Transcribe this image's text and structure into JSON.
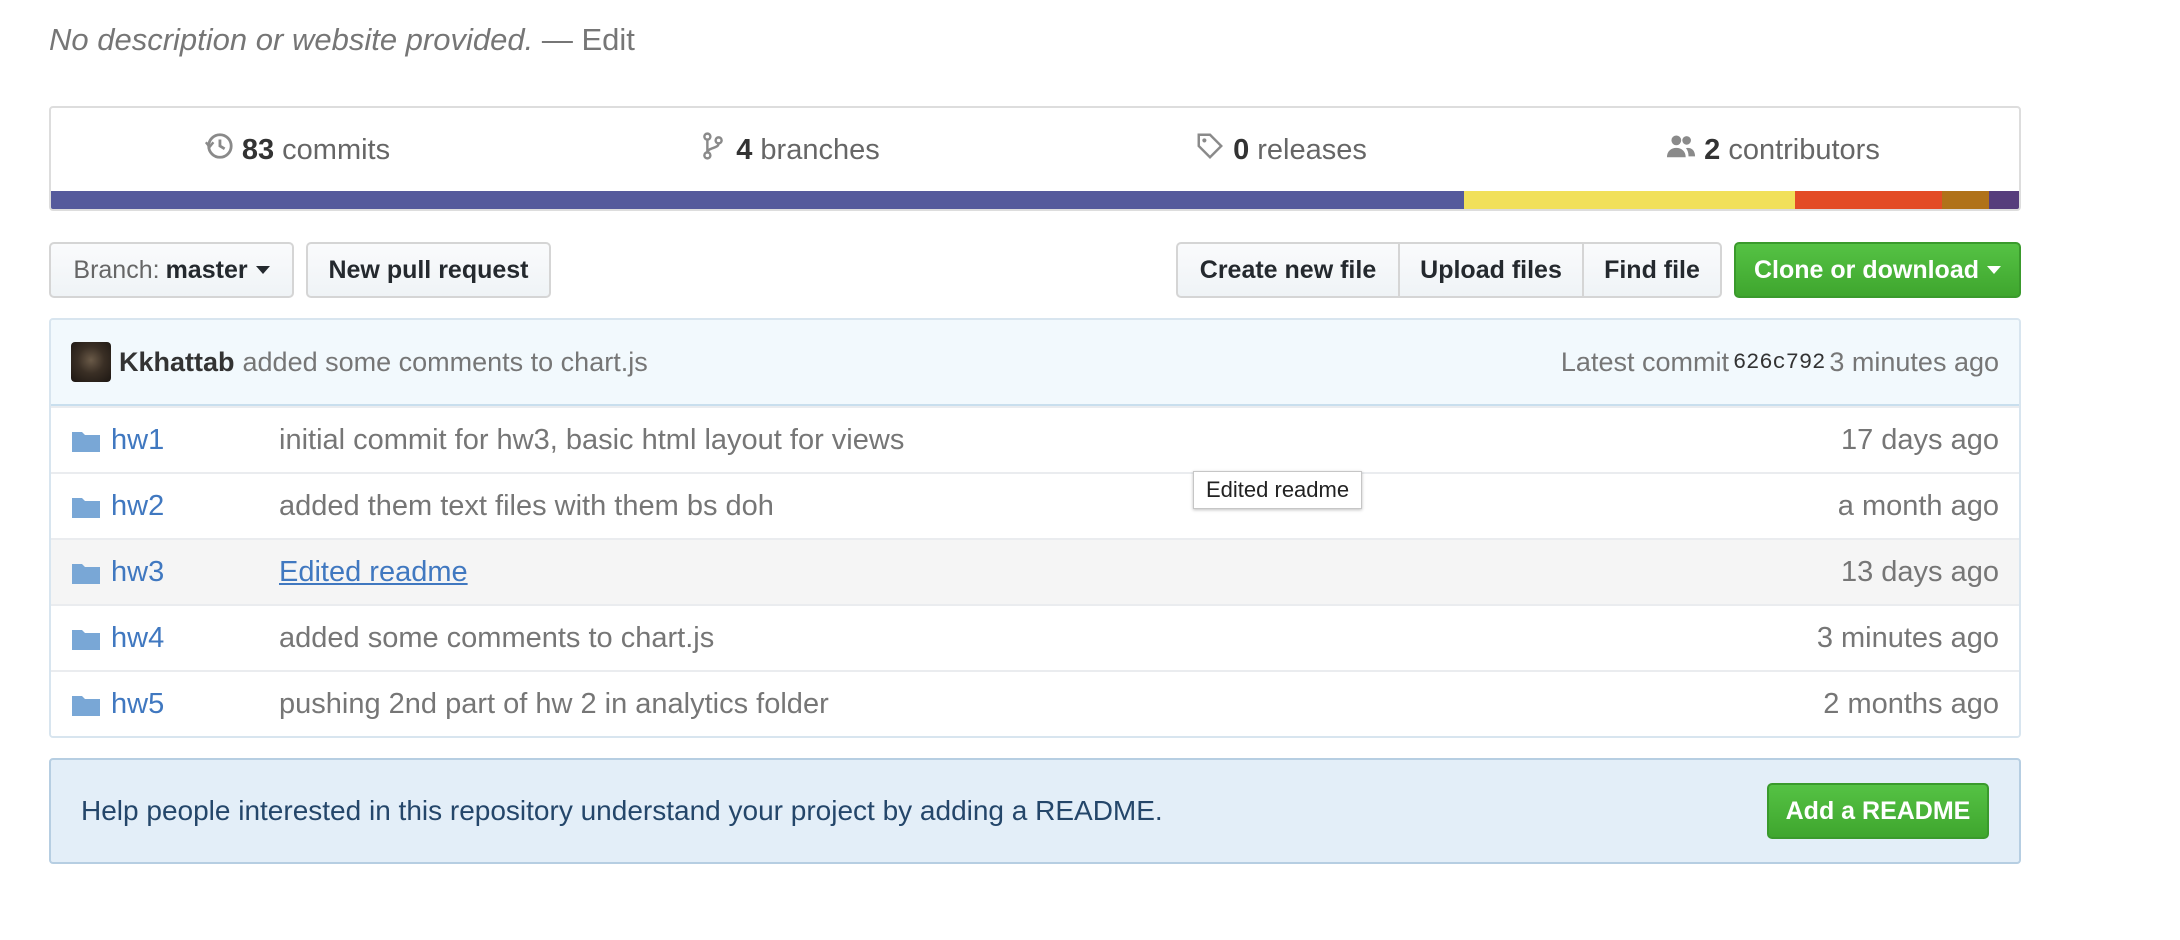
{
  "description": {
    "text": "No description or website provided.",
    "separator": "—",
    "edit_label": "Edit"
  },
  "summary": {
    "commits": {
      "count": "83",
      "label": "commits",
      "icon": "history-icon"
    },
    "branches": {
      "count": "4",
      "label": "branches",
      "icon": "branch-icon"
    },
    "releases": {
      "count": "0",
      "label": "releases",
      "icon": "tag-icon"
    },
    "contributors": {
      "count": "2",
      "label": "contributors",
      "icon": "people-icon"
    },
    "languages": [
      {
        "color": "#555a9c",
        "fraction": 0.718
      },
      {
        "color": "#f1e05a",
        "fraction": 0.168
      },
      {
        "color": "#e34c26",
        "fraction": 0.075
      },
      {
        "color": "#b07219",
        "fraction": 0.024
      },
      {
        "color": "#563d7c",
        "fraction": 0.015
      }
    ]
  },
  "toolbar": {
    "branch_label": "Branch:",
    "branch_value": "master",
    "new_pull_request": "New pull request",
    "create_new_file": "Create new file",
    "upload_files": "Upload files",
    "find_file": "Find file",
    "clone_or_download": "Clone or download"
  },
  "latest_commit": {
    "author": "Kkhattab",
    "message": "added some comments to chart.js",
    "prefix": "Latest commit",
    "sha": "626c792",
    "age": "3 minutes ago"
  },
  "files": [
    {
      "name": "hw1",
      "message": "initial commit for hw3, basic html layout for views",
      "age": "17 days ago"
    },
    {
      "name": "hw2",
      "message": "added them text files with them bs doh",
      "age": "a month ago"
    },
    {
      "name": "hw3",
      "message": "Edited readme",
      "age": "13 days ago"
    },
    {
      "name": "hw4",
      "message": "added some comments to chart.js",
      "age": "3 minutes ago"
    },
    {
      "name": "hw5",
      "message": "pushing 2nd part of hw 2 in analytics folder",
      "age": "2 months ago"
    }
  ],
  "tooltip": {
    "text": "Edited readme"
  },
  "readme_prompt": {
    "text": "Help people interested in this repository understand your project by adding a README.",
    "button": "Add a README"
  },
  "colors": {
    "link": "#4078c0",
    "green_button": "#4cb83b",
    "readme_bg": "#e3eef8"
  }
}
